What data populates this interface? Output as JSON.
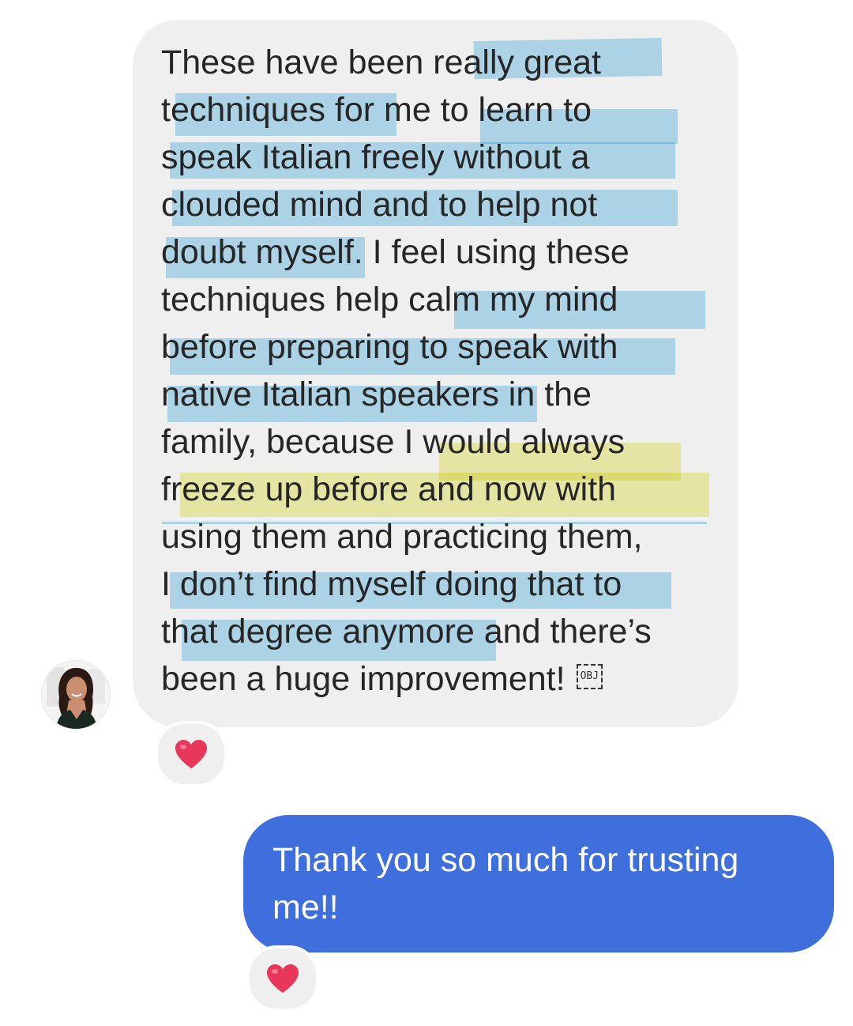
{
  "conversation": {
    "incoming_message": {
      "lines": [
        "These have been really great",
        "techniques for me to learn to",
        "speak Italian freely without a",
        "clouded mind and to help not",
        "doubt myself. I feel using these",
        "techniques help calm my mind",
        "before preparing to speak with",
        "native Italian speakers in the",
        "family, because I would always",
        "freeze up before and now with",
        "using them and practicing them,",
        "I don’t find myself doing that to",
        "that degree anymore and there’s",
        "been a huge improvement!"
      ],
      "object_placeholder": "OBJ",
      "reaction_icon": "heart-icon"
    },
    "outgoing_message": {
      "lines": [
        "Thank you so much for trusting",
        "me!!"
      ],
      "reaction_icon": "heart-icon"
    }
  },
  "colors": {
    "incoming_bubble": "#efefef",
    "outgoing_bubble": "#3e6fdc",
    "highlight_blue": "#7ec8ec",
    "highlight_yellow": "#eeee82",
    "heart": "#e8375a"
  }
}
